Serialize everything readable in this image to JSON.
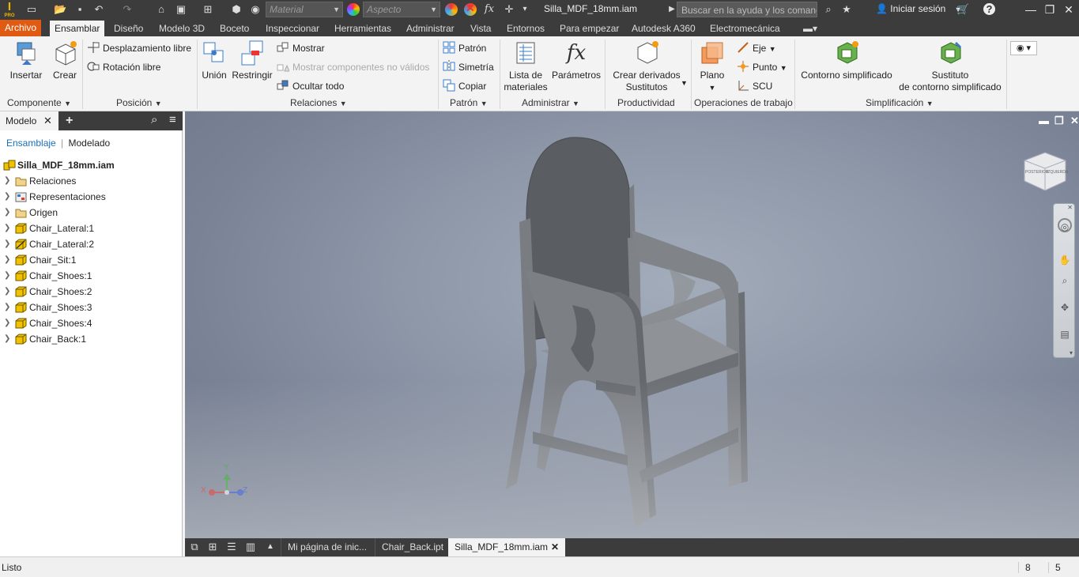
{
  "app": {
    "title": "Silla_MDF_18mm.iam",
    "logo_letter": "I",
    "logo_sub": "PRO"
  },
  "quickaccess": {
    "material_placeholder": "Material",
    "appearance_placeholder": "Aspecto",
    "fx": "fx"
  },
  "search": {
    "placeholder": "Buscar en la ayuda y los comandos"
  },
  "user": {
    "signin_label": "Iniciar sesión"
  },
  "menu_tabs": [
    "Archivo",
    "Ensamblar",
    "Diseño",
    "Modelo 3D",
    "Boceto",
    "Inspeccionar",
    "Herramientas",
    "Administrar",
    "Vista",
    "Entornos",
    "Para empezar",
    "Autodesk A360",
    "Electromecánica"
  ],
  "ribbon": {
    "componente": {
      "title": "Componente",
      "insertar": "Insertar",
      "crear": "Crear"
    },
    "posicion": {
      "title": "Posición",
      "desplazamiento": "Desplazamiento libre",
      "rotacion": "Rotación libre"
    },
    "relaciones": {
      "title": "Relaciones",
      "union": "Unión",
      "restringir": "Restringir",
      "mostrar": "Mostrar",
      "mostrar_no_validos": "Mostrar componentes no válidos",
      "ocultar_todo": "Ocultar todo"
    },
    "patron": {
      "title": "Patrón",
      "patron": "Patrón",
      "simetria": "Simetría",
      "copiar": "Copiar"
    },
    "administrar": {
      "title": "Administrar",
      "lista1": "Lista de",
      "lista2": "materiales",
      "parametros": "Parámetros"
    },
    "productividad": {
      "title": "Productividad",
      "crear1": "Crear derivados",
      "crear2": "Sustitutos"
    },
    "operaciones": {
      "title": "Operaciones de trabajo",
      "plano": "Plano",
      "eje": "Eje",
      "punto": "Punto",
      "scu": "SCU"
    },
    "simplificacion": {
      "title": "Simplificación",
      "contorno": "Contorno simplificado",
      "sustituto1": "Sustituto",
      "sustituto2": "de contorno simplificado"
    }
  },
  "browser": {
    "tab_label": "Modelo",
    "sub_ensamblaje": "Ensamblaje",
    "sub_modelado": "Modelado",
    "root": "Silla_MDF_18mm.iam",
    "items": [
      {
        "label": "Relaciones",
        "icon": "folder-icon"
      },
      {
        "label": "Representaciones",
        "icon": "representations-icon"
      },
      {
        "label": "Origen",
        "icon": "folder-icon"
      },
      {
        "label": "Chair_Lateral:1",
        "icon": "part-icon"
      },
      {
        "label": "Chair_Lateral:2",
        "icon": "part-adaptive-icon"
      },
      {
        "label": "Chair_Sit:1",
        "icon": "part-icon"
      },
      {
        "label": "Chair_Shoes:1",
        "icon": "part-icon"
      },
      {
        "label": "Chair_Shoes:2",
        "icon": "part-icon"
      },
      {
        "label": "Chair_Shoes:3",
        "icon": "part-icon"
      },
      {
        "label": "Chair_Shoes:4",
        "icon": "part-icon"
      },
      {
        "label": "Chair_Back:1",
        "icon": "part-icon"
      }
    ]
  },
  "viewcube": {
    "left": "POSTERIOR",
    "right": "IZQUIERDA"
  },
  "triad": {
    "x": "X",
    "y": "Y",
    "z": "Z"
  },
  "doc_tabs": {
    "home": "Mi página de inic...",
    "back": "Chair_Back.ipt",
    "active": "Silla_MDF_18mm.iam"
  },
  "status": {
    "text": "Listo",
    "num1": "8",
    "num2": "5"
  },
  "colors": {
    "accent": "#e05a12",
    "dark_bar": "#3c3c3c",
    "part_yellow": "#f2c200",
    "model_gray": "#8a8d90"
  }
}
